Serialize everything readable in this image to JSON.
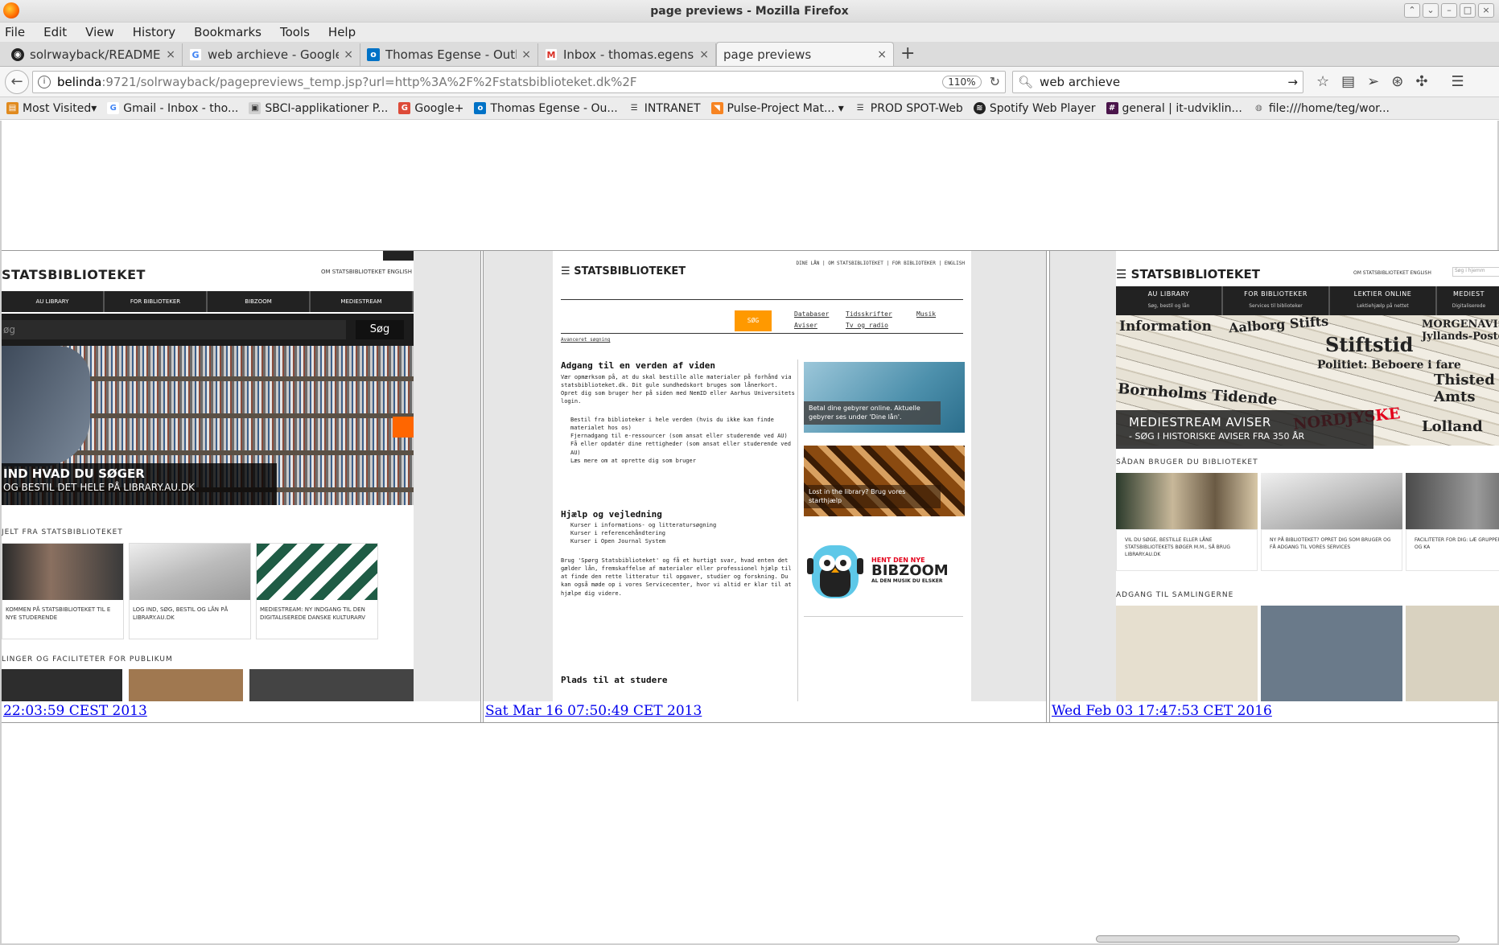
{
  "window": {
    "title": "page previews - Mozilla Firefox"
  },
  "menu": [
    "File",
    "Edit",
    "View",
    "History",
    "Bookmarks",
    "Tools",
    "Help"
  ],
  "tabs": [
    {
      "label": "solrwayback/README.m",
      "icon": "github-icon"
    },
    {
      "label": "web archieve - Google",
      "icon": "google-icon"
    },
    {
      "label": "Thomas Egense - Outlo",
      "icon": "outlook-icon"
    },
    {
      "label": "Inbox - thomas.egense",
      "icon": "gmail-icon"
    },
    {
      "label": "page previews",
      "icon": "none"
    }
  ],
  "nav": {
    "url_host": "belinda",
    "url_path": ":9721/solrwayback/pagepreviews_temp.jsp?url=http%3A%2F%2Fstatsbiblioteket.dk%2F",
    "zoom": "110%",
    "search_value": "web archieve"
  },
  "bookmarks": [
    {
      "label": "Most Visited",
      "icon": "star-icon",
      "dropdown": true
    },
    {
      "label": "Gmail - Inbox - tho...",
      "icon": "google-icon"
    },
    {
      "label": "SBCI-applikationer P...",
      "icon": "sbci-icon"
    },
    {
      "label": "Google+",
      "icon": "gplus-icon"
    },
    {
      "label": "Thomas Egense - Ou...",
      "icon": "outlook-icon"
    },
    {
      "label": "INTRANET",
      "icon": "menu-icon"
    },
    {
      "label": "Pulse-Project Mat...",
      "icon": "rss-icon",
      "dropdown": true
    },
    {
      "label": "PROD SPOT-Web",
      "icon": "menu-icon"
    },
    {
      "label": "Spotify Web Player",
      "icon": "spotify-icon"
    },
    {
      "label": "general | it-udviklin...",
      "icon": "slack-icon"
    },
    {
      "label": "file:///home/teg/wor...",
      "icon": "globe-icon"
    }
  ],
  "previews": [
    {
      "timestamp": "22:03:59 CEST 2013",
      "logo": "STATSBIBLIOTEKET",
      "toplinks": "OM STATSBIBLIOTEKET   ENGLISH",
      "nav": [
        "AU LIBRARY",
        "FOR BIBLIOTEKER",
        "BIBZOOM",
        "MEDIESTREAM"
      ],
      "search_placeholder": "øg",
      "search_button": "Søg",
      "hero_title": "IND HVAD DU SØGER",
      "hero_sub": "OG BESTIL DET HELE PÅ LIBRARY.AU.DK",
      "section1": "JELT FRA STATSBIBLIOTEKET",
      "tiles": [
        "KOMMEN PÅ STATSBIBLIOTEKET TIL E NYE STUDERENDE",
        "LOG IND, SØG, BESTIL OG LÅN PÅ LIBRARY.AU.DK",
        "MEDIESTREAM: NY INDGANG TIL DEN DIGITALISEREDE DANSKE KULTURARV"
      ],
      "section2": "LINGER OG FACILITETER FOR PUBLIKUM"
    },
    {
      "timestamp": "Sat Mar 16 07:50:49 CET 2013",
      "logo": "STATSBIBLIOTEKET",
      "toplinks": "DINE LÅN | OM STATSBIBLIOTEKET | FOR BIBLIOTEKER | ENGLISH",
      "search_button": "SØG",
      "links": [
        "Databaser",
        "Tidsskrifter",
        "Musik",
        "Aviser",
        "Tv og radio"
      ],
      "advanced": "Avanceret søgning",
      "h1": "Adgang til en verden af viden",
      "p1": "Vær opmærksom på, at du skal bestille alle materialer på forhånd via statsbiblioteket.dk. Dit gule sundhedskort bruges som lånerkort. Opret dig som bruger her på siden med NemID eller Aarhus Universitets login.",
      "bullets": [
        "Bestil fra biblioteker i hele verden (hvis du ikke kan finde materialet hos os)",
        "Fjernadgang til e-ressourcer (som ansat eller studerende ved AU)",
        "Få eller opdatér dine rettigheder (som ansat eller studerende ved AU)",
        "Læs mere om at oprette dig som bruger"
      ],
      "h2": "Hjælp og vejledning",
      "bullets2": [
        "Kurser i informations- og litteratursøgning",
        "Kurser i referencehåndtering",
        "Kurser i Open Journal System"
      ],
      "p2": "Brug 'Spørg Statsbiblioteket' og få et hurtigt svar, hvad enten det gælder lån, fremskaffelse af materialer eller professionel hjælp til at finde den rette litteratur til opgaver, studier og forskning. Du kan også møde op i vores Servicecenter, hvor vi altid er klar til at hjælpe dig videre.",
      "h3": "Plads til at studere",
      "ad1": "Betal dine gebyrer online. Aktuelle gebyrer ses under 'Dine lån'.",
      "ad2": "Lost in the library? Brug vores starthjælp",
      "bz_top": "HENT DEN NYE",
      "bz_title": "BIBZOOM",
      "bz_sub": "AL DEN MUSIK DU ELSKER"
    },
    {
      "timestamp": "Wed Feb 03 17:47:53 CET 2016",
      "logo": "STATSBIBLIOTEKET",
      "toplinks": "OM STATSBIBLIOTEKET   ENGLISH",
      "search_placeholder": "Søg i hjemm",
      "nav": [
        {
          "title": "AU LIBRARY",
          "sub": "Søg, bestil og lån"
        },
        {
          "title": "FOR BIBLIOTEKER",
          "sub": "Services til biblioteker"
        },
        {
          "title": "LEKTIER ONLINE",
          "sub": "Lektiehjælp på nettet"
        },
        {
          "title": "MEDIEST",
          "sub": "Digitaliserede"
        }
      ],
      "hero_title": "MEDIESTREAM AVISER",
      "hero_sub": "- SØG I HISTORISKE AVISER FRA 350 ÅR",
      "section1": "SÅDAN BRUGER DU BIBLIOTEKET",
      "tiles": [
        "VIL DU SØGE, BESTILLE ELLER LÅNE STATSBIBLIOTEKETS BØGER M.M., SÅ BRUG LIBRARY.AU.DK",
        "NY PÅ BIBLIOTEKET? OPRET DIG SOM BRUGER OG FÅ ADGANG TIL VORES SERVICES",
        "FACILITETER FOR DIG: LÆ GRUPPERUM, LOUNGE OG KA"
      ],
      "section2": "ADGANG TIL SAMLINGERNE"
    }
  ],
  "colors": {
    "link": "#0000ee",
    "orange": "#ff9900",
    "dark_nav": "#222222"
  }
}
